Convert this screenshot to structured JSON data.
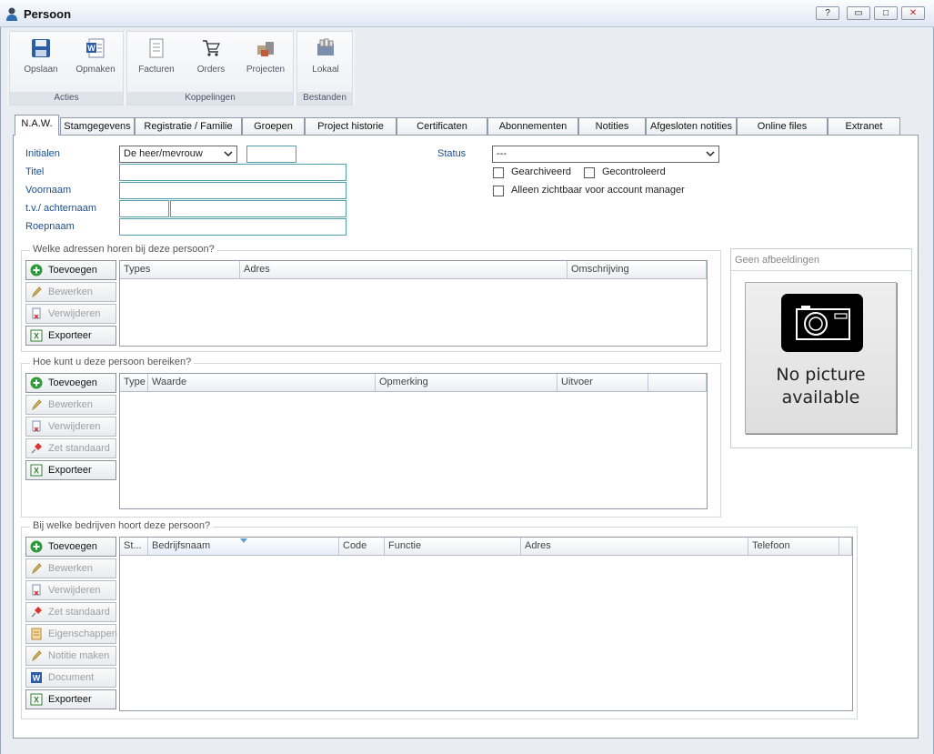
{
  "window": {
    "title": "Persoon",
    "buttons": {
      "help": "?",
      "minimize": "▭",
      "maximize": "□",
      "close": "✕"
    }
  },
  "ribbon": {
    "groups": [
      {
        "label": "Acties",
        "buttons": [
          {
            "label": "Opslaan",
            "icon": "save-icon"
          },
          {
            "label": "Opmaken",
            "icon": "word-icon"
          }
        ]
      },
      {
        "label": "Koppelingen",
        "buttons": [
          {
            "label": "Facturen",
            "icon": "invoice-icon"
          },
          {
            "label": "Orders",
            "icon": "cart-icon"
          },
          {
            "label": "Projecten",
            "icon": "projects-icon"
          }
        ]
      },
      {
        "label": "Bestanden",
        "buttons": [
          {
            "label": "Lokaal",
            "icon": "folder-icon"
          }
        ]
      }
    ]
  },
  "tabs": [
    "N.A.W.",
    "Stamgegevens",
    "Registratie / Familie",
    "Groepen",
    "Project historie",
    "Certificaten",
    "Abonnementen",
    "Notities",
    "Afgesloten notities",
    "Online files",
    "Extranet"
  ],
  "form": {
    "initialen_label": "Initialen",
    "aanhef_value": "De heer/mevrouw",
    "titel_label": "Titel",
    "voornaam_label": "Voornaam",
    "achternaam_label": "t.v./ achternaam",
    "roepnaam_label": "Roepnaam",
    "status_label": "Status",
    "status_value": "---",
    "gearchiveerd_label": "Gearchiveerd",
    "gecontroleerd_label": "Gecontroleerd",
    "account_manager_label": "Alleen zichtbaar voor account manager"
  },
  "adressen": {
    "title": "Welke adressen horen bij deze persoon?",
    "buttons": [
      "Toevoegen",
      "Bewerken",
      "Verwijderen",
      "Exporteer"
    ],
    "columns": [
      "Types",
      "Adres",
      "Omschrijving"
    ]
  },
  "contact": {
    "title": "Hoe kunt u deze persoon bereiken?",
    "buttons": [
      "Toevoegen",
      "Bewerken",
      "Verwijderen",
      "Zet standaard",
      "Exporteer"
    ],
    "columns": [
      "Type",
      "Waarde",
      "Opmerking",
      "Uitvoer"
    ]
  },
  "bedrijven": {
    "title": "Bij welke bedrijven hoort deze persoon?",
    "buttons": [
      "Toevoegen",
      "Bewerken",
      "Verwijderen",
      "Zet standaard",
      "Eigenschappen",
      "Notitie maken",
      "Document",
      "Exporteer"
    ],
    "columns": [
      "St...",
      "Bedrijfsnaam",
      "Code",
      "Functie",
      "Adres",
      "Telefoon"
    ]
  },
  "picture": {
    "header": "Geen afbeeldingen",
    "line1": "No picture",
    "line2": "available"
  }
}
